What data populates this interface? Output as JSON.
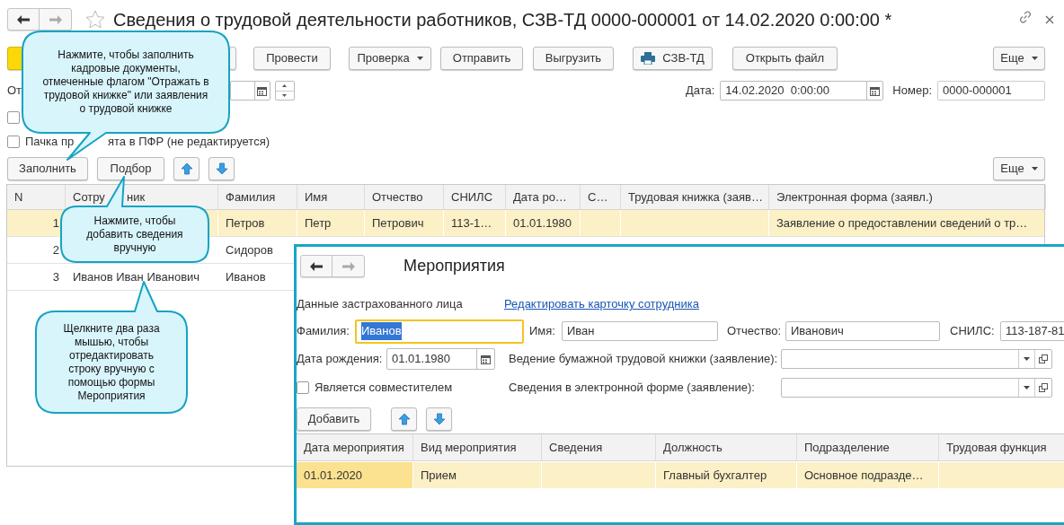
{
  "window": {
    "title": "Сведения о трудовой деятельности работников, СЗВ-ТД 0000-000001 от 14.02.2020 0:00:00 *"
  },
  "toolbar": [
    {
      "label": "Провести",
      "kind": "button"
    },
    {
      "label": "Проверка",
      "kind": "dropdown"
    },
    {
      "label": "Отправить",
      "kind": "button"
    },
    {
      "label": "Выгрузить",
      "kind": "button"
    },
    {
      "label": "СЗВ-ТД",
      "kind": "print"
    },
    {
      "label": "Открыть файл",
      "kind": "button"
    }
  ],
  "more_button": "Еще",
  "period_label": "От",
  "date": {
    "label": "Дата:",
    "value": "14.02.2020  0:00:00"
  },
  "number": {
    "label": "Номер:",
    "value": "0000-000001"
  },
  "checkboxes": [
    {
      "checked": false
    },
    {
      "label_parts": [
        "Пачка пр",
        "ята в ПФР (не редактируется)"
      ],
      "checked": false
    }
  ],
  "grid_buttons": [
    "Заполнить",
    "Подбор"
  ],
  "grid_more_button": "Еще",
  "table": {
    "columns": [
      "N",
      [
        "Сотру",
        "ник"
      ],
      "Фамилия",
      "Имя",
      "Отчество",
      "СНИЛС",
      "Дата ро…",
      "С…",
      "Трудовая книжка (заяв…",
      "Электронная форма (заявл.)"
    ],
    "rows": [
      {
        "n": "1",
        "surname": "Петров",
        "first_name": "Петр",
        "patronymic": "Петрович",
        "snils": "113-1…",
        "birth_date": "01.01.1980",
        "electronic_form": "Заявление о предоставлении сведений о тр…",
        "selected": true
      },
      {
        "n": "2",
        "surname": "Сидоров",
        "selected": false
      },
      {
        "n": "3",
        "employee": "Иванов Иван Иванович",
        "surname": "Иванов",
        "selected": false
      }
    ]
  },
  "dialog": {
    "title": "Мероприятия",
    "section": "Данные застрахованного лица",
    "link": "Редактировать карточку сотрудника",
    "fields": [
      {
        "label": "Фамилия:",
        "value": "Иванов",
        "focused": true
      },
      {
        "label": "Имя:",
        "value": "Иван",
        "focused": false
      },
      {
        "label": "Отчество:",
        "value": "Иванович",
        "focused": false
      },
      {
        "label": "СНИЛС:",
        "value": "113-187-81",
        "focused": false
      }
    ],
    "birth_date": {
      "label": "Дата рождения:",
      "value": "01.01.1980"
    },
    "combos": [
      {
        "label": "Ведение бумажной трудовой книжки (заявление):"
      },
      {
        "label": "Сведения в электронной форме (заявление):"
      }
    ],
    "checkbox": {
      "label": "Является совместителем",
      "checked": false
    },
    "add_button": "Добавить",
    "table": {
      "columns": [
        "Дата мероприятия",
        "Вид мероприятия",
        "Сведения",
        "Должность",
        "Подразделение",
        "Трудовая функция"
      ],
      "rows": [
        {
          "date": "01.01.2020",
          "type": "Прием",
          "position": "Главный бухгалтер",
          "department": "Основное подразде…",
          "selected": true
        }
      ]
    }
  },
  "callouts": [
    {
      "text": "Нажмите, чтобы заполнить\nкадровые документы,\nотмеченные флагом \"Отражать в\nтрудовой книжке\" или заявления\nо трудовой книжке"
    },
    {
      "text": "Нажмите, чтобы\nдобавить сведения\nвручную"
    },
    {
      "text": "Щелкните два раза\nмышью, чтобы\nотредактировать\nстроку вручную с\nпомощью формы\nМероприятия"
    }
  ]
}
